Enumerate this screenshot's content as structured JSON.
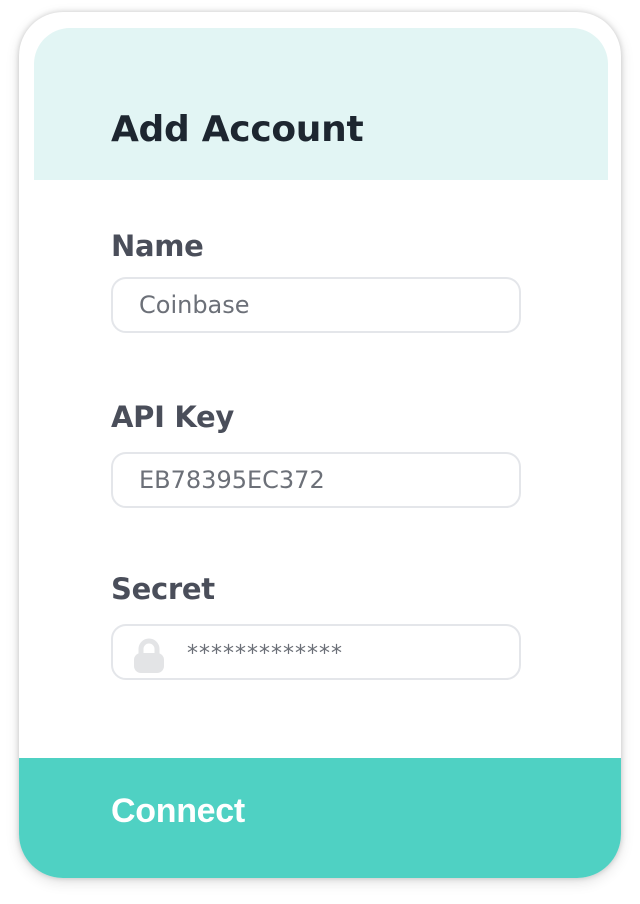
{
  "header": {
    "title": "Add Account"
  },
  "form": {
    "name": {
      "label": "Name",
      "value": "Coinbase"
    },
    "api_key": {
      "label": "API Key",
      "value": "EB78395EC372"
    },
    "secret": {
      "label": "Secret",
      "value": "*************",
      "icon": "lock-icon"
    }
  },
  "actions": {
    "connect_label": "Connect"
  },
  "colors": {
    "header_background": "#e2f5f4",
    "accent": "#4fd1c3",
    "title_text": "#1d2630",
    "label_text": "#4a4e5a",
    "field_border": "#e4e6ea"
  }
}
